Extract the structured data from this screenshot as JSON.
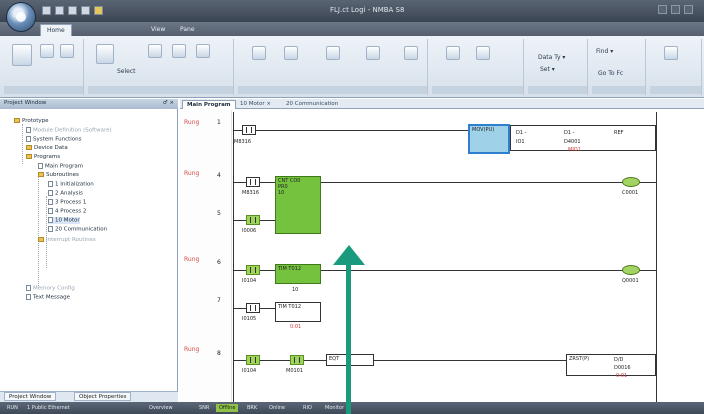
{
  "titlebar": {
    "title": "FLJ.ct Logi - NMBA S8"
  },
  "tabs": {
    "home": "Home",
    "view": "View",
    "pane": "Pane"
  },
  "ribbon": {
    "select_label": "Select",
    "data_type": "Data Ty  ▾",
    "set_label": "Set  ▾",
    "find_label": "Find  ▾",
    "goto_label": "Go To  Fc"
  },
  "project_window": {
    "header": "Project Window",
    "pin": "♂ ×",
    "tree": [
      "Prototype",
      "Module Definition (Software)",
      "System Functions",
      "Device Data",
      "Programs",
      "Main Program",
      "Subroutines",
      "1 Initialization",
      "2 Analysis",
      "3 Process 1",
      "4 Process 2",
      "10 Motor",
      "20 Communication",
      "Interrupt Routines",
      "Memory Config",
      "Text Message"
    ],
    "bottom_tabs": {
      "project": "Project Window",
      "object": "Object Properties"
    }
  },
  "program_tabs": {
    "main": "Main Program",
    "sub1": "10 Motor ×",
    "sub2": "20 Communication"
  },
  "rungs": [
    {
      "label": "Rung",
      "number": "1",
      "contact": "M8316",
      "fb": "MOV(PU)",
      "fb_args": [
        "D1 -",
        "D1 -",
        "REF"
      ],
      "arg_line2": [
        "IO1",
        "D4001"
      ],
      "arg_red": "MIO1"
    },
    {
      "label": "Rung",
      "number": "4",
      "contact": "M8316",
      "fb_line1": "CNT CO0",
      "fb_line2": "PR0",
      "fb_line3": "10",
      "coil": "C0001"
    },
    {
      "number": "5",
      "contact": "I0006"
    },
    {
      "label": "Rung",
      "number": "6",
      "contact": "I0104",
      "timer": "TIM T012",
      "timer_val": "10",
      "coil": "Q0001"
    },
    {
      "number": "7",
      "contact": "I0105",
      "timer": "TIM T012",
      "timer_red": "0:01"
    },
    {
      "label": "Rung",
      "number": "8",
      "contact1": "I0104",
      "contact2": "M0101",
      "fb": "EQT",
      "fb_right": "ZRST(P)",
      "fb_right_args": [
        "D/D",
        "D0016"
      ],
      "fb_right_red": "0:01"
    }
  ],
  "statusbar": {
    "items": [
      "RUN",
      "1 Public Ethernet",
      "Overview",
      "SNR",
      "Offline",
      "BRK",
      "Online",
      "RIO",
      "Monitor"
    ],
    "highlight_index": 4
  },
  "colors": {
    "annotation_arrow": "#1a9a7d",
    "contact_on": "#9fd45a",
    "function_block": "#74c23e",
    "selected_block": "#9fd1e8"
  }
}
